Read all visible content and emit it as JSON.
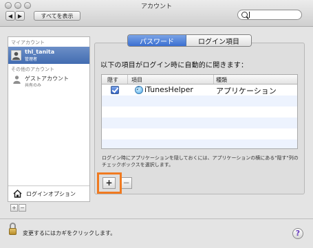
{
  "window": {
    "title": "アカウント"
  },
  "toolbar": {
    "back_label": "◀",
    "forward_label": "▶",
    "show_all_label": "すべてを表示",
    "search_value": ""
  },
  "sidebar": {
    "my_account_header": "マイアカウント",
    "current_user": {
      "name": "thl_tanita",
      "role": "管理者"
    },
    "other_accounts_header": "その他のアカウント",
    "guest": {
      "name": "ゲストアカウント",
      "role": "共有のみ"
    },
    "login_options_label": "ログインオプション",
    "add_label": "+",
    "remove_label": "−"
  },
  "tabs": [
    {
      "label": "パスワード",
      "selected": true
    },
    {
      "label": "ログイン項目",
      "selected": false
    }
  ],
  "login_items": {
    "heading": "以下の項目がログイン時に自動的に開きます：",
    "columns": [
      "隠す",
      "項目",
      "種類"
    ],
    "rows": [
      {
        "hide": true,
        "item": "iTunesHelper",
        "kind": "アプリケーション"
      }
    ],
    "note": "ログイン時にアプリケーションを隠しておくには、アプリケーションの横にある\"隠す\"列のチェックボックスを選択します。",
    "add_label": "+",
    "remove_label": "−"
  },
  "footer": {
    "lock_text": "変更するにはカギをクリックします。",
    "help_label": "?"
  },
  "colors": {
    "highlight": "#f07a20",
    "selection": "#426cb1"
  }
}
